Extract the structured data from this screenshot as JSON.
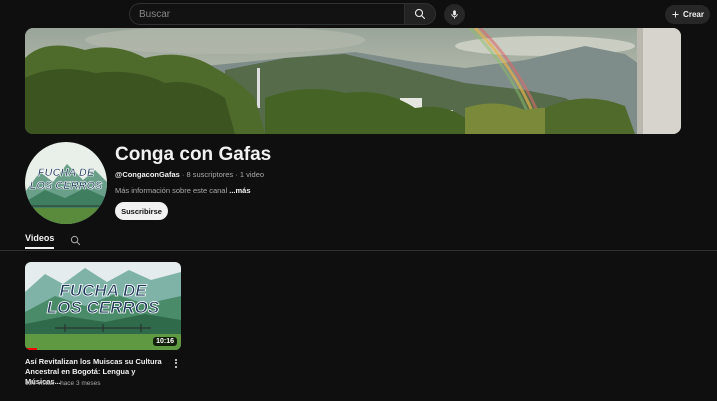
{
  "header": {
    "search_placeholder": "Buscar",
    "create_label": "Crear"
  },
  "channel": {
    "title": "Conga con Gafas",
    "handle": "@CongaconGafas",
    "separator": " · ",
    "subscribers": "8 suscriptores",
    "video_count": "1 video",
    "description": "Más información sobre este canal ",
    "more_label": "...más",
    "subscribe_label": "Suscribirse",
    "avatar_text_line1": "FUCHA DE",
    "avatar_text_line2": "LOS CERROS"
  },
  "tabs": [
    {
      "label": "Videos",
      "active": true
    }
  ],
  "videos": [
    {
      "title": "Así Revitalizan los Muiscas su Cultura Ancestral en Bogotá: Lengua y Músicas...",
      "views": "136 vistas",
      "age": "hace 3 meses",
      "duration": "10:16",
      "thumb_text_line1": "FUCHA DE",
      "thumb_text_line2": "LOS CERROS",
      "watched_fraction": 0.08
    }
  ],
  "icons": {
    "search": "search-icon",
    "mic": "mic-icon",
    "plus": "plus-icon",
    "kebab": "more-vert-icon"
  },
  "colors": {
    "background": "#0f0f0f",
    "accent_red": "#ff0000",
    "text_primary": "#f1f1f1",
    "text_secondary": "#aaaaaa"
  }
}
